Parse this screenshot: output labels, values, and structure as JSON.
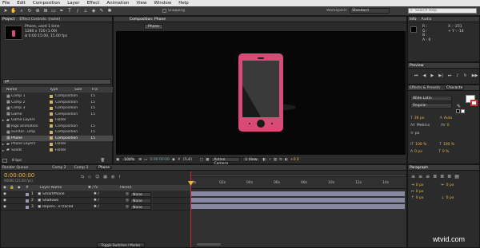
{
  "menu": [
    "File",
    "Edit",
    "Composition",
    "Layer",
    "Effect",
    "Animation",
    "View",
    "Window",
    "Help"
  ],
  "toolbar": {
    "snapping": "Snapping",
    "workspace_label": "Workspace:",
    "workspace_value": "Standard",
    "search_placeholder": "Search Help"
  },
  "project": {
    "tabs": [
      "Project",
      "Effect Controls: (none)"
    ],
    "comp_name": "Phone",
    "used_text": ", used 1 time",
    "dims": "1280 x 720 (1.00)",
    "duration": "Δ 0:00:15:00, 15.00 fps",
    "search_placeholder": "ρ▾",
    "col_name": "Name",
    "col_type": "Type",
    "col_size": "Size",
    "col_fps": "Fra",
    "items": [
      {
        "name": "Comp 1",
        "type": "Composition",
        "size": "15",
        "color": "#c8b46a",
        "kind": "comp"
      },
      {
        "name": "Comp 2",
        "type": "Composition",
        "size": "15",
        "color": "#c8b46a",
        "kind": "comp"
      },
      {
        "name": "Comp 3",
        "type": "Composition",
        "size": "15",
        "color": "#c8b46a",
        "kind": "comp"
      },
      {
        "name": "Game",
        "type": "Composition",
        "size": "15",
        "color": "#c8b46a",
        "kind": "comp"
      },
      {
        "name": "Game Layers",
        "type": "Folder",
        "size": "",
        "color": "#c8b46a",
        "kind": "folder"
      },
      {
        "name": "logo animation",
        "type": "Composition",
        "size": "15",
        "color": "#c8b46a",
        "kind": "comp"
      },
      {
        "name": "ourstor...ump",
        "type": "Composition",
        "size": "15",
        "color": "#c8b46a",
        "kind": "comp"
      },
      {
        "name": "Phone",
        "type": "Composition",
        "size": "15",
        "color": "#c8b46a",
        "kind": "comp",
        "selected": true
      },
      {
        "name": "Phone Layers",
        "type": "Folder",
        "size": "",
        "color": "#c8b46a",
        "kind": "folder"
      },
      {
        "name": "Solids",
        "type": "Folder",
        "size": "",
        "color": "#c8b46a",
        "kind": "folder"
      }
    ],
    "bpc": "8 bpc"
  },
  "viewer": {
    "tab": "Composition: Phone",
    "sub_tab": "Phone",
    "zoom": "100%",
    "timecode": "0:00:00:00",
    "res": "(Full)",
    "camera": "Active Camera",
    "view": "1 View",
    "exposure": "+0.0"
  },
  "info": {
    "tabs": [
      "Info",
      "Audio"
    ],
    "r": "R :",
    "g": "G :",
    "b": "B :",
    "a": "A : 0",
    "x": "X : -251",
    "y": "+ Y : -14"
  },
  "preview": {
    "tab": "Preview"
  },
  "effects": {
    "tabs": [
      "Effects & Presets",
      "Characte"
    ],
    "font": "Wide Latin",
    "style": "Regular",
    "font_size": "36 px",
    "leading": "Auto",
    "kerning": "Metrics",
    "tracking": "0",
    "unit": "px",
    "vscale": "100 %",
    "hscale": "100 %",
    "baseline": "0 px",
    "tsume": "0 %"
  },
  "timeline": {
    "tabs": [
      "Render Queue",
      "Comp 2",
      "Comp 3",
      "Phone"
    ],
    "timecode": "0:00:00:00",
    "frames": "00000 (15.00 fps)",
    "col_layer": "Layer Name",
    "col_parent": "Parent",
    "layers": [
      {
        "num": "1",
        "name": "SmartPhone",
        "parent": "None"
      },
      {
        "num": "2",
        "name": "Shadows",
        "parent": "None"
      },
      {
        "num": "3",
        "name": "Reprev...e traced",
        "parent": "None"
      }
    ],
    "ruler": [
      "0s",
      "02s",
      "04s",
      "06s",
      "08s",
      "10s",
      "12s",
      "14s"
    ],
    "toggle": "Toggle Switches / Modes"
  },
  "paragraph": {
    "tab": "Paragraph",
    "indent_a": "0 px",
    "indent_b": "0 px",
    "indent_c": "0 px",
    "space_a": "0 px",
    "space_b": "0 px"
  },
  "watermark": "wtvid.com",
  "colors": {
    "phone": "#d94a76",
    "accent": "#f0b43c",
    "playhead": "#c8283a"
  }
}
